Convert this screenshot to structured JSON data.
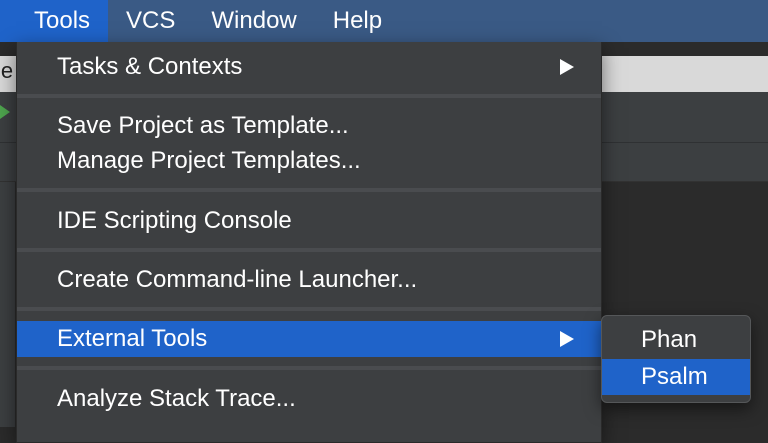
{
  "menubar": {
    "items": [
      {
        "label": "Tools"
      },
      {
        "label": "VCS"
      },
      {
        "label": "Window"
      },
      {
        "label": "Help"
      }
    ]
  },
  "background": {
    "title_fragment": "le"
  },
  "tools_menu": {
    "items": [
      {
        "label": "Tasks & Contexts"
      },
      {
        "label": "Save Project as Template..."
      },
      {
        "label": "Manage Project Templates..."
      },
      {
        "label": "IDE Scripting Console"
      },
      {
        "label": "Create Command-line Launcher..."
      },
      {
        "label": "External Tools"
      },
      {
        "label": "Analyze Stack Trace..."
      }
    ]
  },
  "external_tools_submenu": {
    "items": [
      {
        "label": "Phan"
      },
      {
        "label": "Psalm"
      }
    ]
  },
  "colors": {
    "menubar_bg": "#3a5a85",
    "menu_bg": "#3d3f41",
    "highlight": "#1f63c9",
    "separator": "#4a4c4f"
  }
}
